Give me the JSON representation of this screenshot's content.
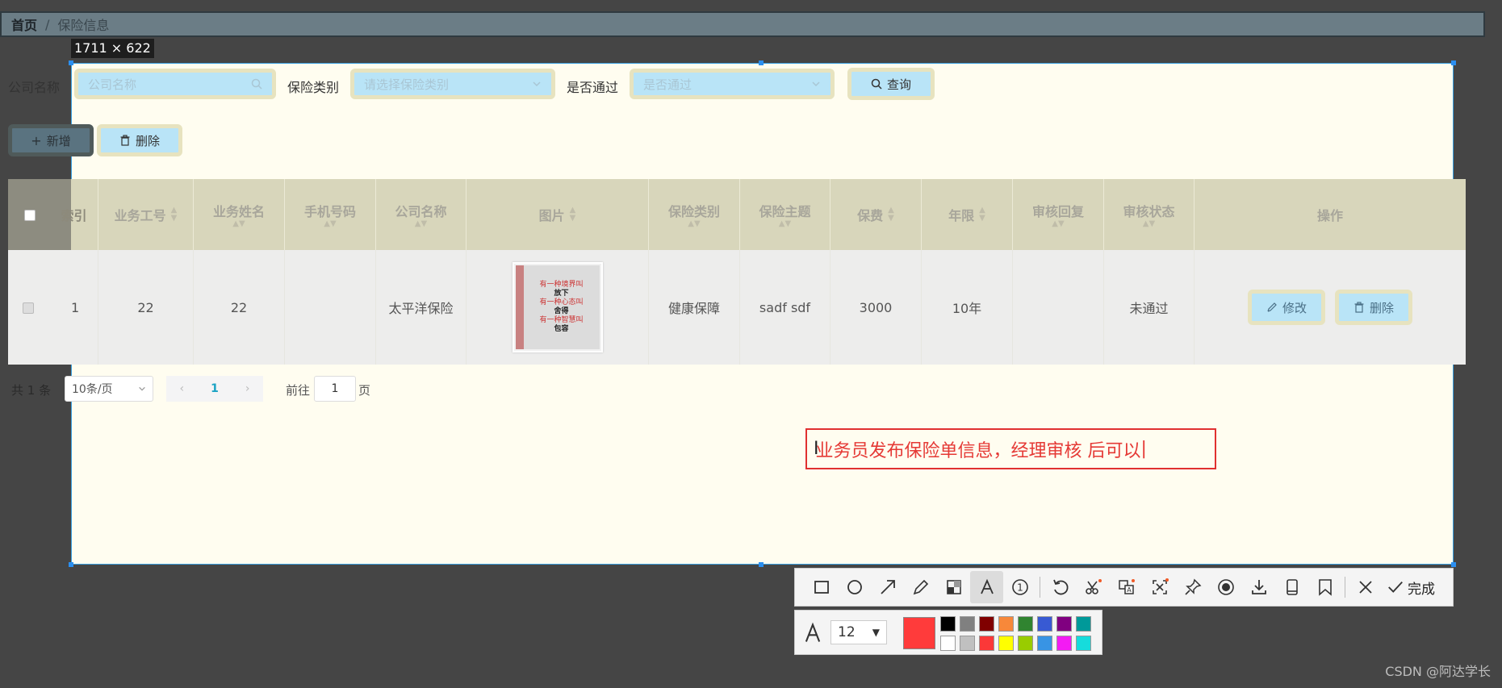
{
  "breadcrumb": {
    "home": "首页",
    "separator": "/",
    "current": "保险信息"
  },
  "selection": {
    "size_label": "1711 × 622"
  },
  "search": {
    "company_label": "公司名称",
    "company_placeholder": "公司名称",
    "category_label": "保险类别",
    "category_placeholder": "请选择保险类别",
    "passed_label": "是否通过",
    "passed_placeholder": "是否通过",
    "query_button": "查询"
  },
  "actions": {
    "add_button": "新增",
    "delete_button": "删除"
  },
  "table": {
    "columns": [
      "索引",
      "业务工号",
      "业务姓名",
      "手机号码",
      "公司名称",
      "图片",
      "保险类别",
      "保险主题",
      "保费",
      "年限",
      "审核回复",
      "审核状态",
      "操作"
    ],
    "rows": [
      {
        "index": "1",
        "staff_id": "22",
        "staff_name": "22",
        "phone": "",
        "company": "太平洋保险",
        "category": "健康保障",
        "theme": "sadf sdf",
        "premium": "3000",
        "term": "10年",
        "reply": "",
        "status": "未通过",
        "edit": "修改",
        "delete": "删除",
        "image_lines": [
          "有一种境界叫",
          "放下",
          "有一种心态叫",
          "舍得",
          "有一种智慧叫",
          "包容"
        ]
      }
    ]
  },
  "pagination": {
    "total": "共 1 条",
    "page_size": "10条/页",
    "current_page": "1",
    "goto_label": "前往",
    "goto_value": "1",
    "page_suffix": "页"
  },
  "annotation": {
    "text": "业务员发布保险单信息，经理审核 后可以"
  },
  "toolbar": {
    "tools": [
      "rectangle-icon",
      "ellipse-icon",
      "arrow-icon",
      "pencil-icon",
      "mosaic-icon",
      "text-icon",
      "number-icon",
      "undo-icon",
      "ocr-icon",
      "translate-icon",
      "long-screenshot-icon",
      "pin-icon",
      "record-icon",
      "download-icon",
      "device-icon",
      "bookmark-icon"
    ],
    "close": "close-icon",
    "done_label": "完成",
    "font_size": "12",
    "selected_color": "#ff3b3b",
    "palette": [
      "#000000",
      "#808080",
      "#800000",
      "#f7883a",
      "#308430",
      "#385ad3",
      "#800080",
      "#009999",
      "#ffffff",
      "#c0c0c0",
      "#fb3838",
      "#ffff00",
      "#99cc00",
      "#3894e4",
      "#f31bf3",
      "#16dcdc"
    ]
  },
  "watermark": "CSDN @阿达学长"
}
